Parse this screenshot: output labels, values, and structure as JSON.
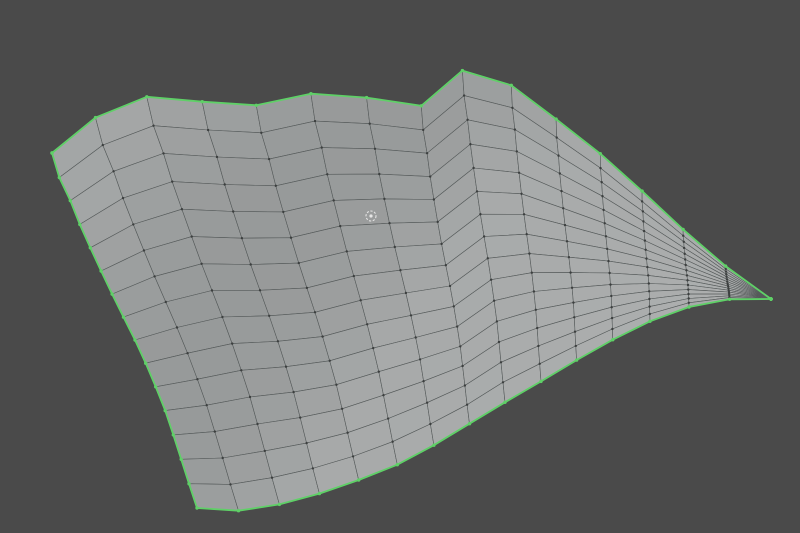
{
  "app": {
    "view": "3d-viewport",
    "object_type": "mesh-plane",
    "mode": "edit",
    "boundary_selected": true
  },
  "mesh": {
    "grid_columns": 15,
    "grid_rows": 15,
    "shading": "solid"
  },
  "colors": {
    "background": "#4a4a4a",
    "surface_light": "#b4b6b6",
    "surface_dark": "#8c8f8f",
    "wire": "#555a5a",
    "vertex": "#3c3f3f",
    "selection": "#5fd067",
    "origin_marker": "#e6e6e6"
  },
  "icons": {
    "origin": "object-origin-icon",
    "vertex": "mesh-vertex-icon"
  }
}
